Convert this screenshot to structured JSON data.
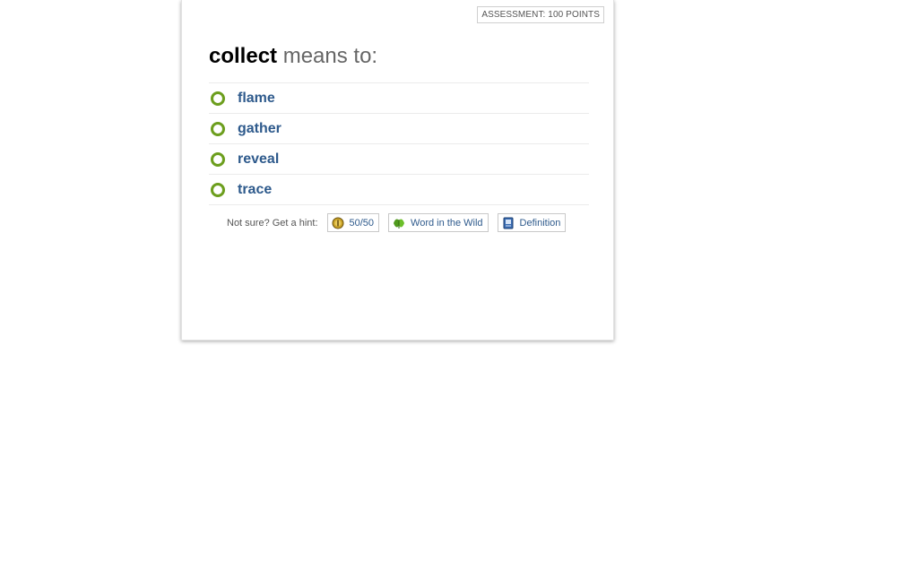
{
  "assessment": {
    "badge": "ASSESSMENT: 100 POINTS"
  },
  "question": {
    "word": "collect",
    "prompt": " means to:"
  },
  "choices": [
    {
      "label": "flame"
    },
    {
      "label": "gather"
    },
    {
      "label": "reveal"
    },
    {
      "label": "trace"
    }
  ],
  "hints": {
    "prompt": "Not sure? Get a hint:",
    "buttons": [
      {
        "label": "50/50",
        "icon": "coin-icon"
      },
      {
        "label": "Word in the Wild",
        "icon": "leaf-icon"
      },
      {
        "label": "Definition",
        "icon": "book-icon"
      }
    ]
  },
  "colors": {
    "radio_ring": "#6c9e1d",
    "choice_text": "#2e5a8c",
    "word_text": "#000000",
    "prompt_text": "#666666"
  }
}
